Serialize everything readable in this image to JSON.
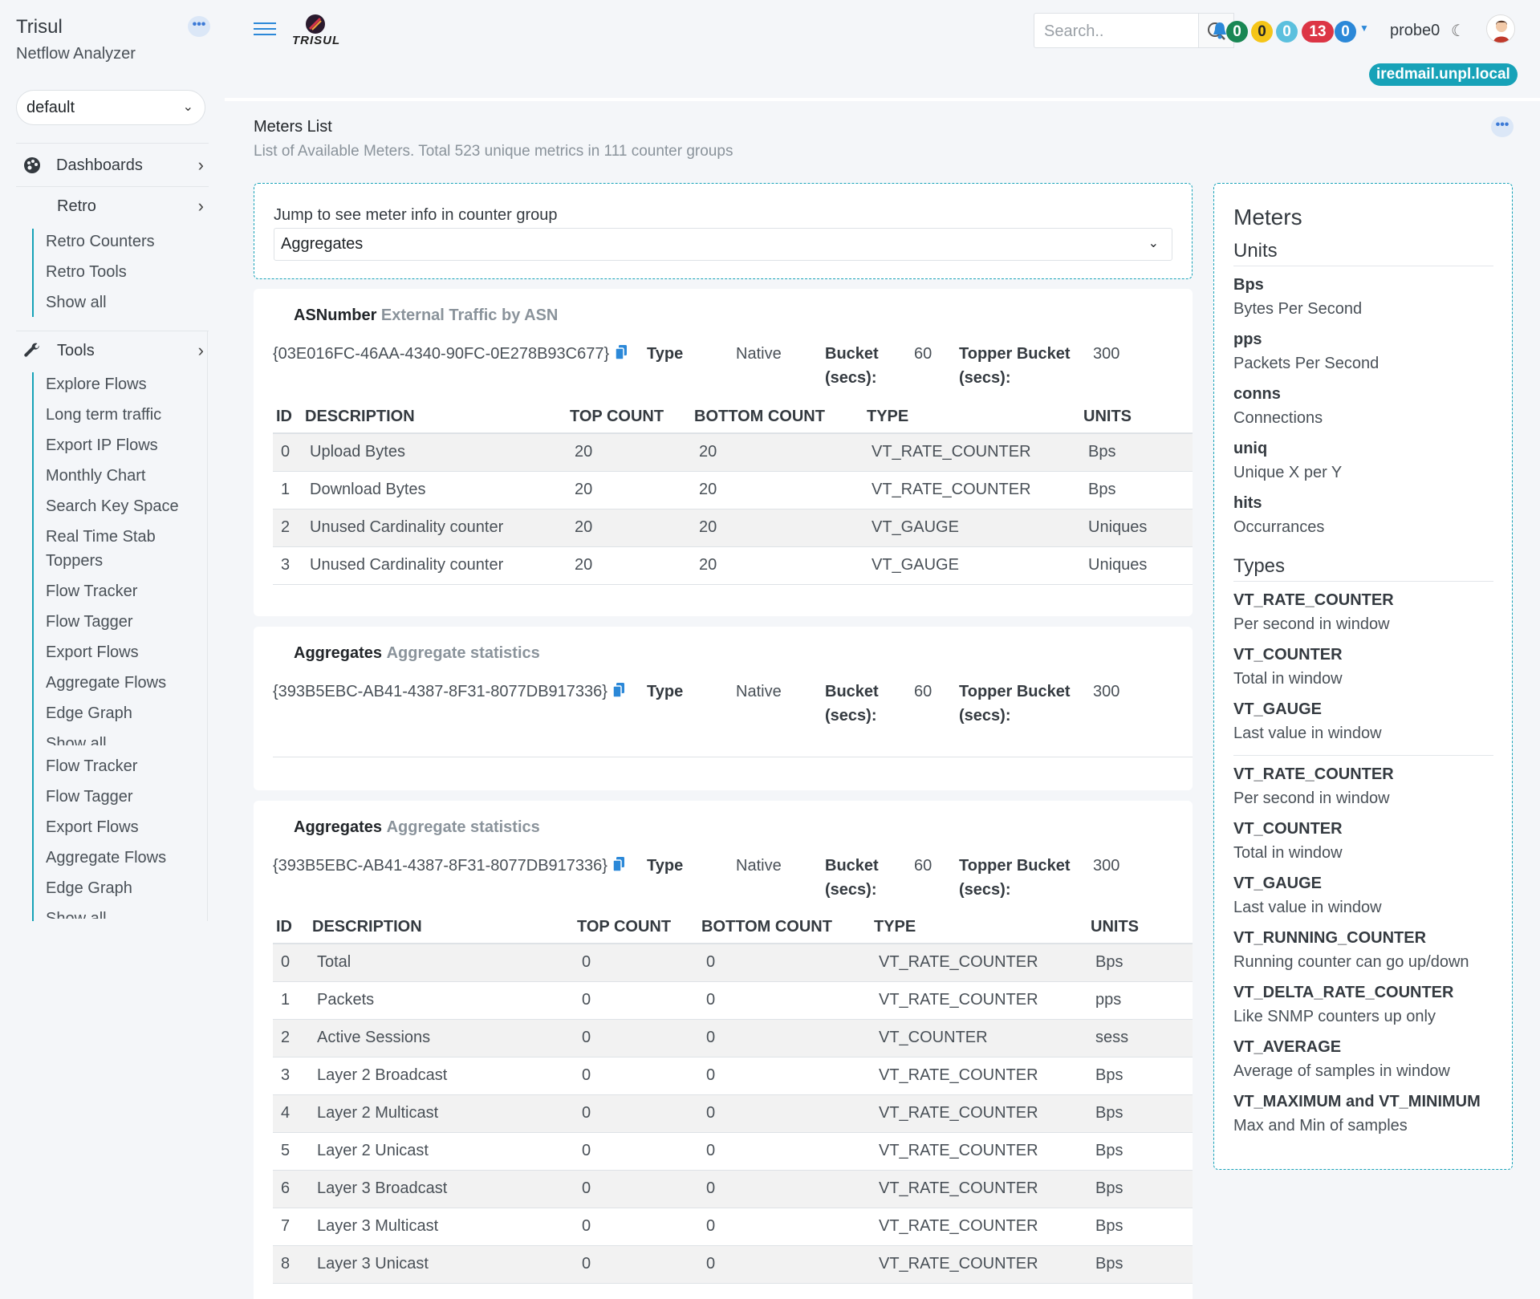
{
  "app": {
    "title": "Trisul",
    "subtitle": "Netflow Analyzer",
    "menu_dots": "•••",
    "context": "default",
    "logo_text": "TRISUL"
  },
  "sidebar": {
    "dashboards": "Dashboards",
    "retro": "Retro",
    "retro_links": [
      "Retro Counters",
      "Retro Tools",
      "Show all"
    ],
    "tools": "Tools",
    "tools_links": [
      "Explore Flows",
      "Long term traffic",
      "Export IP Flows",
      "Monthly Chart",
      "Search Key Space",
      "Real Time Stab Toppers",
      "Flow Tracker",
      "Flow Tagger",
      "Export Flows",
      "Aggregate Flows",
      "Edge Graph",
      "Show all"
    ],
    "tools_links_repeat": [
      "Flow Tracker",
      "Flow Tagger",
      "Export Flows",
      "Aggregate Flows",
      "Edge Graph",
      "Show all"
    ]
  },
  "header": {
    "search_placeholder": "Search..",
    "badges": [
      {
        "value": "0",
        "color": "#198754"
      },
      {
        "value": "0",
        "color": "#f5c518"
      },
      {
        "value": "0",
        "color": "#5bc0de"
      },
      {
        "value": "13",
        "color": "#dc3545"
      },
      {
        "value": "0",
        "color": "#2b88d8"
      }
    ],
    "probe": "probe0",
    "host": "iredmail.unpl.local"
  },
  "page": {
    "title": "Meters List",
    "subtitle": "List of Available Meters. Total 523 unique metrics in 111 counter groups",
    "jump_label": "Jump to see meter info in counter group",
    "jump_value": "Aggregates"
  },
  "labels": {
    "type": "Type",
    "bucket": "Bucket",
    "secs": "(secs):",
    "topper_bucket": "Topper Bucket"
  },
  "columns": [
    "ID",
    "DESCRIPTION",
    "TOP COUNT",
    "BOTTOM COUNT",
    "TYPE",
    "UNITS"
  ],
  "groups": [
    {
      "name": "ASNumber",
      "desc": "External Traffic by ASN",
      "guid": "{03E016FC-46AA-4340-90FC-0E278B93C677}",
      "type": "Native",
      "bucket": "60",
      "topper": "300",
      "rows": [
        [
          "0",
          "Upload Bytes",
          "20",
          "20",
          "VT_RATE_COUNTER",
          "Bps"
        ],
        [
          "1",
          "Download Bytes",
          "20",
          "20",
          "VT_RATE_COUNTER",
          "Bps"
        ],
        [
          "2",
          "Unused Cardinality counter",
          "20",
          "20",
          "VT_GAUGE",
          "Uniques"
        ],
        [
          "3",
          "Unused Cardinality counter",
          "20",
          "20",
          "VT_GAUGE",
          "Uniques"
        ]
      ]
    },
    {
      "name": "Aggregates",
      "desc": "Aggregate statistics",
      "guid": "{393B5EBC-AB41-4387-8F31-8077DB917336}",
      "type": "Native",
      "bucket": "60",
      "topper": "300"
    },
    {
      "name": "Aggregates",
      "desc": "Aggregate statistics",
      "guid": "{393B5EBC-AB41-4387-8F31-8077DB917336}",
      "type": "Native",
      "bucket": "60",
      "topper": "300",
      "rows": [
        [
          "0",
          "Total",
          "0",
          "0",
          "VT_RATE_COUNTER",
          "Bps"
        ],
        [
          "1",
          "Packets",
          "0",
          "0",
          "VT_RATE_COUNTER",
          "pps"
        ],
        [
          "2",
          "Active Sessions",
          "0",
          "0",
          "VT_COUNTER",
          "sess"
        ],
        [
          "3",
          "Layer 2 Broadcast",
          "0",
          "0",
          "VT_RATE_COUNTER",
          "Bps"
        ],
        [
          "4",
          "Layer 2 Multicast",
          "0",
          "0",
          "VT_RATE_COUNTER",
          "Bps"
        ],
        [
          "5",
          "Layer 2 Unicast",
          "0",
          "0",
          "VT_RATE_COUNTER",
          "Bps"
        ],
        [
          "6",
          "Layer 3 Broadcast",
          "0",
          "0",
          "VT_RATE_COUNTER",
          "Bps"
        ],
        [
          "7",
          "Layer 3 Multicast",
          "0",
          "0",
          "VT_RATE_COUNTER",
          "Bps"
        ],
        [
          "8",
          "Layer 3 Unicast",
          "0",
          "0",
          "VT_RATE_COUNTER",
          "Bps"
        ]
      ]
    }
  ],
  "meters_panel": {
    "title": "Meters",
    "units_heading": "Units",
    "units": [
      {
        "t": "Bps",
        "d": "Bytes Per Second"
      },
      {
        "t": "pps",
        "d": "Packets Per Second"
      },
      {
        "t": "conns",
        "d": "Connections"
      },
      {
        "t": "uniq",
        "d": "Unique X per Y"
      },
      {
        "t": "hits",
        "d": "Occurrances"
      }
    ],
    "types_heading": "Types",
    "types_first": [
      {
        "t": "VT_RATE_COUNTER",
        "d": "Per second in window"
      },
      {
        "t": "VT_COUNTER",
        "d": "Total in window"
      },
      {
        "t": "VT_GAUGE",
        "d": "Last value in window"
      }
    ],
    "types": [
      {
        "t": "VT_RATE_COUNTER",
        "d": "Per second in window"
      },
      {
        "t": "VT_COUNTER",
        "d": "Total in window"
      },
      {
        "t": "VT_GAUGE",
        "d": "Last value in window"
      },
      {
        "t": "VT_RUNNING_COUNTER",
        "d": "Running counter can go up/down"
      },
      {
        "t": "VT_DELTA_RATE_COUNTER",
        "d": "Like SNMP counters up only"
      },
      {
        "t": "VT_AVERAGE",
        "d": "Average of samples in window"
      },
      {
        "t": "VT_MAXIMUM and VT_MINIMUM",
        "d": "Max and Min of samples"
      }
    ]
  }
}
